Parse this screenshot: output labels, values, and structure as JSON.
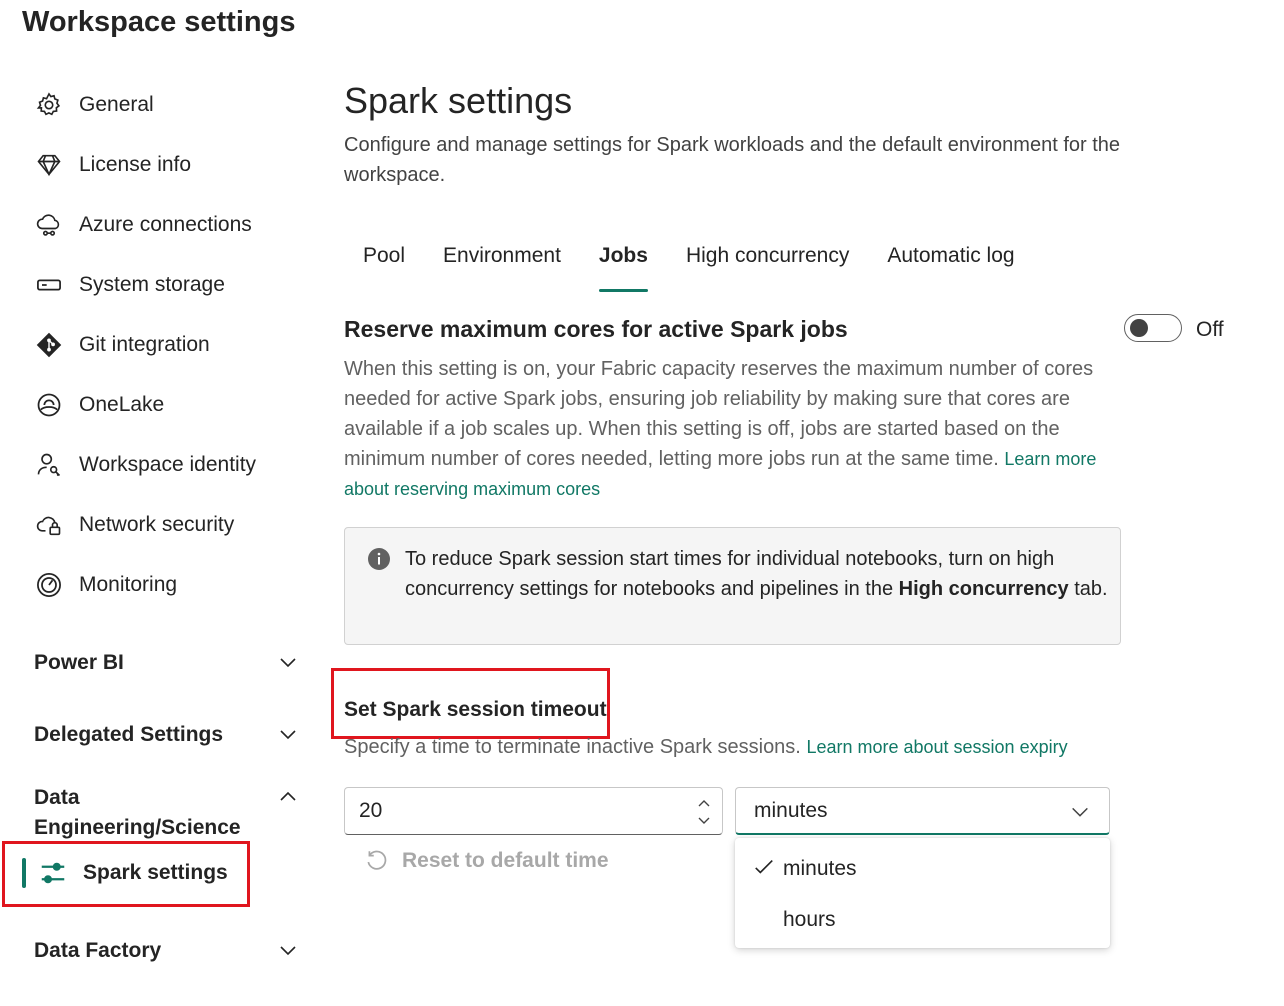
{
  "page_title": "Workspace settings",
  "nav": {
    "items": [
      {
        "label": "General",
        "icon": "gear-icon"
      },
      {
        "label": "License info",
        "icon": "diamond-icon"
      },
      {
        "label": "Azure connections",
        "icon": "cloud-link-icon"
      },
      {
        "label": "System storage",
        "icon": "storage-icon"
      },
      {
        "label": "Git integration",
        "icon": "git-icon"
      },
      {
        "label": "OneLake",
        "icon": "onelake-icon"
      },
      {
        "label": "Workspace identity",
        "icon": "person-key-icon"
      },
      {
        "label": "Network security",
        "icon": "cloud-lock-icon"
      },
      {
        "label": "Monitoring",
        "icon": "gauge-icon"
      }
    ],
    "sections": {
      "power_bi": "Power BI",
      "delegated": "Delegated Settings",
      "data_eng": "Data Engineering/Science",
      "data_factory": "Data Factory"
    },
    "selected_item": "Spark settings"
  },
  "main": {
    "title": "Spark settings",
    "description": "Configure and manage settings for Spark workloads and the default environment for the workspace.",
    "tabs": [
      {
        "label": "Pool"
      },
      {
        "label": "Environment"
      },
      {
        "label": "Jobs"
      },
      {
        "label": "High concurrency"
      },
      {
        "label": "Automatic log"
      }
    ],
    "active_tab": "Jobs",
    "reserve": {
      "title": "Reserve maximum cores for active Spark jobs",
      "toggle_state": "Off",
      "body": "When this setting is on, your Fabric capacity reserves the maximum number of cores needed for active Spark jobs, ensuring job reliability by making sure that cores are available if a job scales up. When this setting is off, jobs are started based on the minimum number of cores needed, letting more jobs run at the same time.",
      "link": "Learn more about reserving maximum cores"
    },
    "info": {
      "text_before": "To reduce Spark session start times for individual notebooks, turn on high concurrency settings for notebooks and pipelines in the",
      "bold": "High concurrency",
      "text_after": "tab."
    },
    "timeout": {
      "title": "Set Spark session timeout",
      "description": "Specify a time to terminate inactive Spark sessions.",
      "link": "Learn more about session expiry",
      "value": "20",
      "unit": "minutes",
      "reset_label": "Reset to default time",
      "options": [
        "minutes",
        "hours"
      ]
    }
  },
  "colors": {
    "accent": "#117865",
    "highlight": "#e0161e"
  }
}
